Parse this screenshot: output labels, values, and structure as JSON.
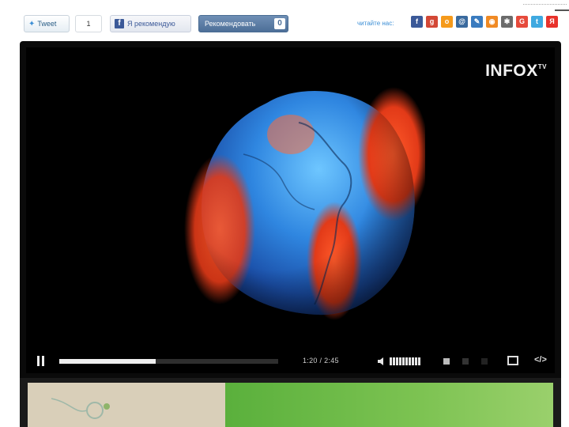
{
  "share_bar": {
    "tweet_label": "Tweet",
    "tweet_count": "1",
    "fb_label": "Я рекомендую",
    "vk_label": "Рекомендовать",
    "vk_badge": "0",
    "follow_label": "читайте нас:",
    "social_icons": [
      {
        "name": "facebook-icon",
        "color": "#3b5998",
        "glyph": "f"
      },
      {
        "name": "google-plus-icon",
        "color": "#d34836",
        "glyph": "g"
      },
      {
        "name": "odnoklassniki-icon",
        "color": "#f59a1b",
        "glyph": "о"
      },
      {
        "name": "moi-mir-icon",
        "color": "#3a6a9e",
        "glyph": "@"
      },
      {
        "name": "livejournal-icon",
        "color": "#3a7bbf",
        "glyph": "✎"
      },
      {
        "name": "rss-icon",
        "color": "#f08a24",
        "glyph": "◉"
      },
      {
        "name": "blogger-icon",
        "color": "#6b6b6b",
        "glyph": "✱"
      },
      {
        "name": "google-icon",
        "color": "#e64a3b",
        "glyph": "G"
      },
      {
        "name": "twitter-icon",
        "color": "#3fa9e0",
        "glyph": "t"
      },
      {
        "name": "yandex-icon",
        "color": "#e8322b",
        "glyph": "Я"
      }
    ]
  },
  "player": {
    "logo_text": "INFOX",
    "logo_suffix": "TV",
    "progress": 0.44,
    "time_current": "1:20",
    "time_total": "2:45",
    "volume_level": 1.0,
    "colors": {
      "background": "#0a0a0a",
      "track": "#2e2e2e",
      "fill": "#eeeeee"
    }
  },
  "thumbnail": {
    "left_color": "#d9cfb9",
    "right_color": "#6cba45"
  }
}
